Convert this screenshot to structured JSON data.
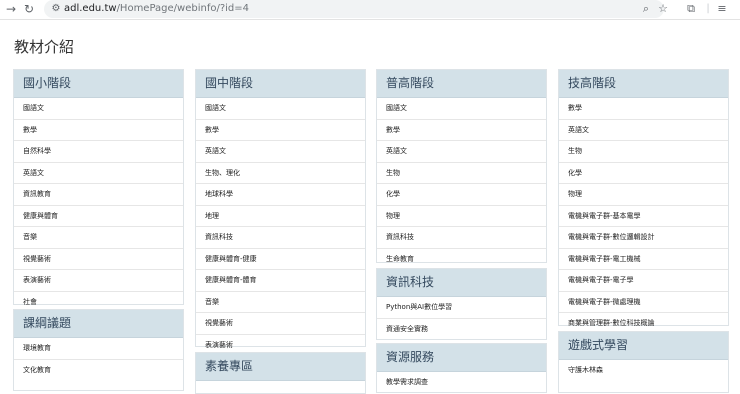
{
  "browser": {
    "url_host": "adl.edu.tw",
    "url_path": "/HomePage/webinfo/?id=4"
  },
  "page": {
    "title": "教材介紹"
  },
  "panels": [
    {
      "title": "國小階段",
      "items": [
        "國語文",
        "數學",
        "自然科學",
        "英語文",
        "資訊教育",
        "健康與體育",
        "音樂",
        "視覺藝術",
        "表演藝術",
        "社會"
      ]
    },
    {
      "title": "課綱議題",
      "items": [
        "環境教育",
        "文化教育"
      ]
    },
    {
      "title": "國中階段",
      "items": [
        "國語文",
        "數學",
        "英語文",
        "生物、理化",
        "地球科學",
        "地理",
        "資訊科技",
        "健康與體育-健康",
        "健康與體育-體育",
        "音樂",
        "視覺藝術",
        "表演藝術"
      ]
    },
    {
      "title": "素養專區",
      "items": []
    },
    {
      "title": "普高階段",
      "items": [
        "國語文",
        "數學",
        "英語文",
        "生物",
        "化學",
        "物理",
        "資訊科技",
        "生命教育"
      ]
    },
    {
      "title": "資訊科技",
      "items": [
        "Python與AI數位學習",
        "資通安全實務"
      ]
    },
    {
      "title": "資源服務",
      "items": [
        "教學需求調查"
      ]
    },
    {
      "title": "技高階段",
      "items": [
        "數學",
        "英語文",
        "生物",
        "化學",
        "物理",
        "電機與電子群-基本電學",
        "電機與電子群-數位邏輯設計",
        "電機與電子群-電工機械",
        "電機與電子群-電子學",
        "電機與電子群-微處理機",
        "商業與管理群-數位科技概論"
      ]
    },
    {
      "title": "遊戲式學習",
      "items": [
        "守護木林森"
      ]
    }
  ]
}
